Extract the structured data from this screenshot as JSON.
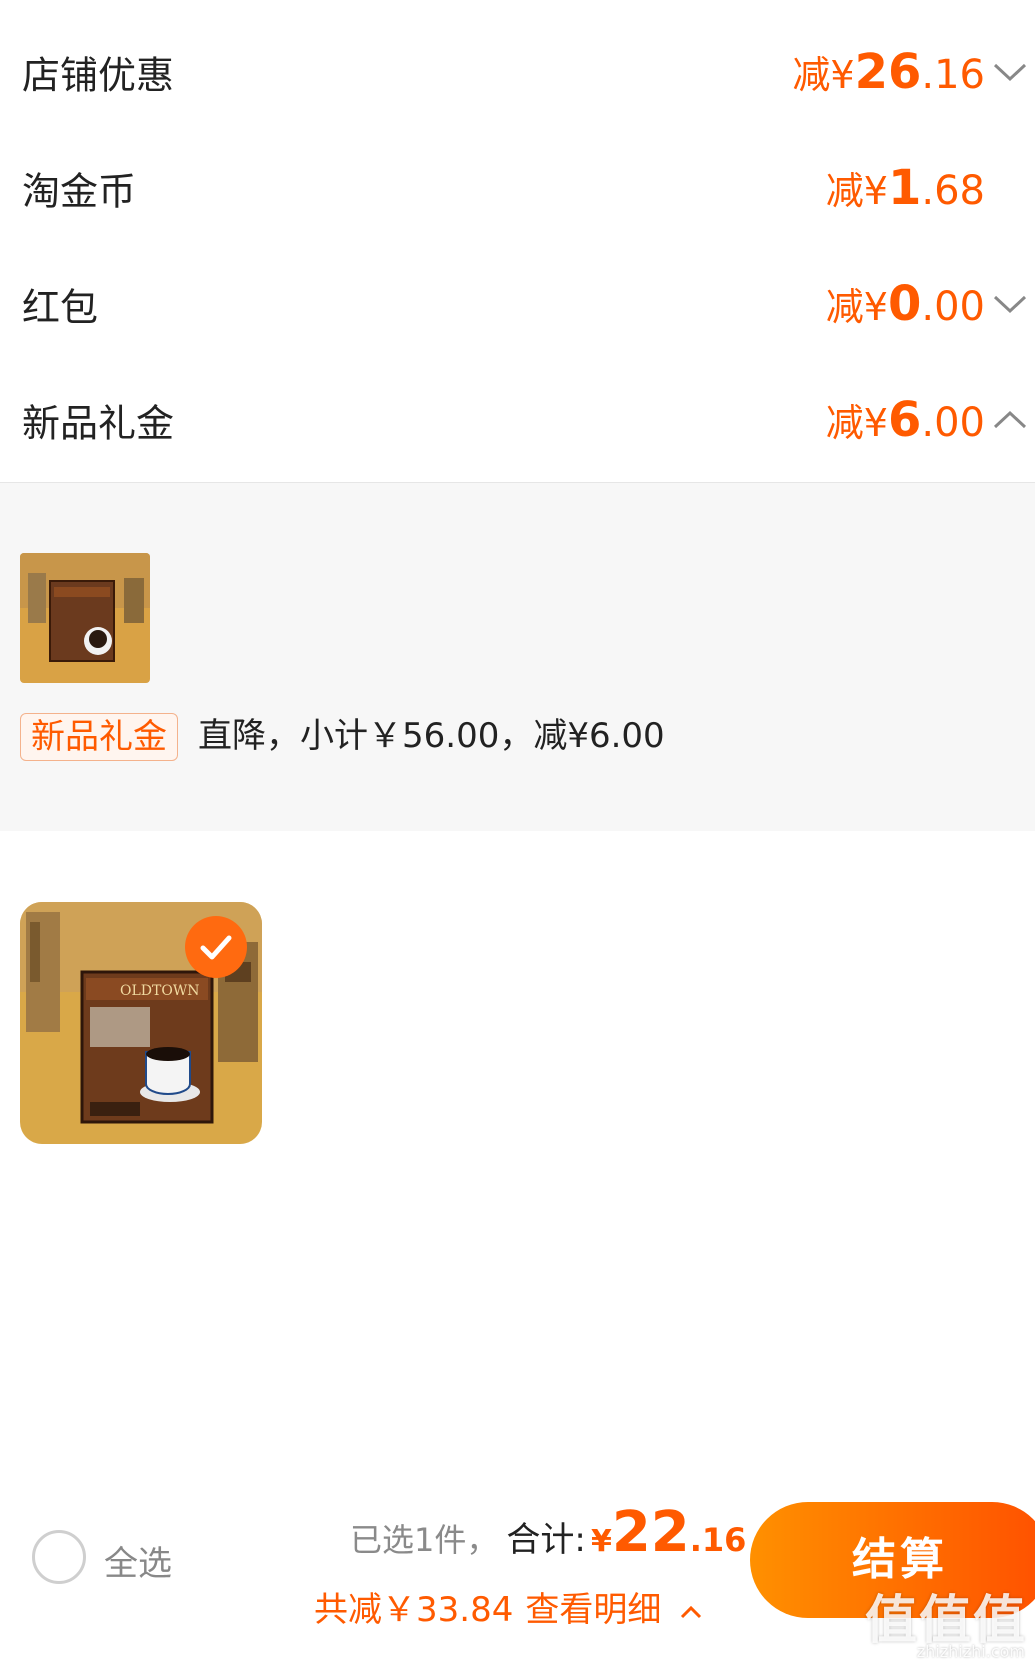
{
  "discounts": [
    {
      "label": "店铺优惠",
      "prefix": "减¥",
      "int": "26",
      "dec": ".16",
      "chevron": "down"
    },
    {
      "label": "淘金币",
      "prefix": "减¥",
      "int": "1",
      "dec": ".68",
      "chevron": "none"
    },
    {
      "label": "红包",
      "prefix": "减¥",
      "int": "0",
      "dec": ".00",
      "chevron": "down"
    },
    {
      "label": "新品礼金",
      "prefix": "减¥",
      "int": "6",
      "dec": ".00",
      "chevron": "up"
    }
  ],
  "panel": {
    "tag": "新品礼金",
    "description": "直降，小计￥56.00，减¥6.00"
  },
  "product": {
    "brand": "OLDTOWN",
    "selected": true
  },
  "bottom_bar": {
    "select_all": "全选",
    "selected_count": "已选1件，",
    "total_label": "合计:",
    "total_prefix": "¥",
    "total_int": "22",
    "total_dec": ".16",
    "saved": "共减￥33.84",
    "detail": "查看明细",
    "checkout": "结算"
  },
  "watermark": {
    "text": "值值值",
    "url": "zhizhizhi.com"
  },
  "colors": {
    "accent": "#ff5a00",
    "checkout_gradient_start": "#ff9000",
    "checkout_gradient_end": "#ff5000"
  },
  "icons": {
    "chevron_down": "chevron-down-icon",
    "chevron_up": "chevron-up-icon",
    "check": "check-icon",
    "radio": "radio-unchecked-icon"
  }
}
